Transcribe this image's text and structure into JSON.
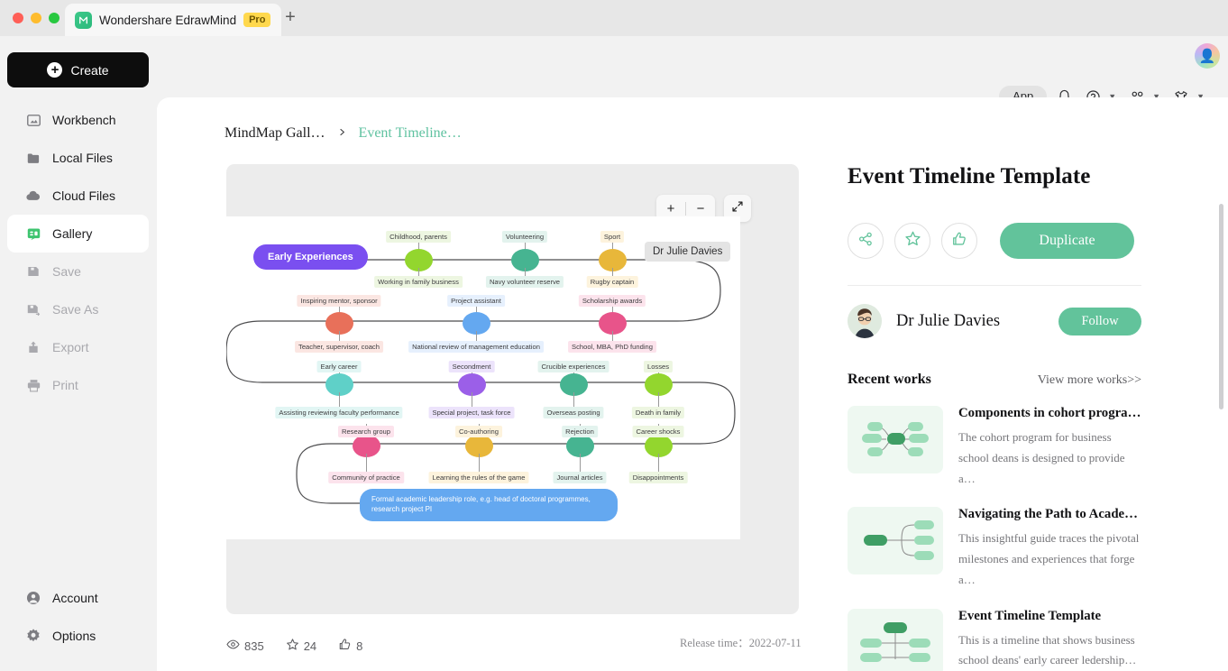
{
  "window": {
    "tab_title": "Wondershare EdrawMind",
    "pro_badge": "Pro",
    "favicon": "edrawmind-logo-icon",
    "new_tab": "+"
  },
  "topbar": {
    "app_label": "App",
    "icons": [
      "bell-icon",
      "help-icon",
      "apps-grid-icon",
      "theme-shirt-icon"
    ],
    "avatar": "user-avatar"
  },
  "sidebar": {
    "create_label": "Create",
    "items": [
      {
        "label": "Workbench",
        "icon": "workbench-icon",
        "state": "normal"
      },
      {
        "label": "Local Files",
        "icon": "folder-icon",
        "state": "normal"
      },
      {
        "label": "Cloud Files",
        "icon": "cloud-icon",
        "state": "normal"
      },
      {
        "label": "Gallery",
        "icon": "gallery-icon",
        "state": "active"
      },
      {
        "label": "Save",
        "icon": "save-icon",
        "state": "disabled"
      },
      {
        "label": "Save As",
        "icon": "save-as-icon",
        "state": "disabled"
      },
      {
        "label": "Export",
        "icon": "export-icon",
        "state": "disabled"
      },
      {
        "label": "Print",
        "icon": "print-icon",
        "state": "disabled"
      }
    ],
    "bottom_items": [
      {
        "label": "Account",
        "icon": "account-icon"
      },
      {
        "label": "Options",
        "icon": "gear-icon"
      }
    ]
  },
  "breadcrumb": {
    "first": "MindMap Gall…",
    "separator": "›",
    "current": "Event Timeline…"
  },
  "preview": {
    "zoom_in": "+",
    "zoom_out": "−",
    "expand": "expand-icon",
    "watermark": "Dr Julie Davies"
  },
  "chart_data": {
    "type": "diagram",
    "title": "Event Timeline Template",
    "root": {
      "label": "Early Experiences",
      "color": "#7a4ff0"
    },
    "banner": "Formal academic leadership role, e.g. head of doctoral programmes, research project PI",
    "banner_color": "#64a8f0",
    "rows": [
      {
        "row": 1,
        "nodes": [
          {
            "color": "#93d62e",
            "above": "Childhood, parents",
            "below": "Working in family business",
            "above_bg": "#edf6e1",
            "below_bg": "#edf6e1"
          },
          {
            "color": "#46b491",
            "above": "Volunteering",
            "below": "Navy volunteer reserve",
            "above_bg": "#e3f3ee",
            "below_bg": "#e3f3ee"
          },
          {
            "color": "#e8b73a",
            "above": "Sport",
            "below": "Rugby captain",
            "above_bg": "#fdf3dd",
            "below_bg": "#fdf3dd"
          }
        ]
      },
      {
        "row": 2,
        "nodes": [
          {
            "color": "#e8705a",
            "above": "Inspiring mentor, sponsor",
            "below": "Teacher, supervisor, coach",
            "above_bg": "#fbe6e2",
            "below_bg": "#fbe6e2"
          },
          {
            "color": "#64a8f0",
            "above": "Project assistant",
            "below": "National review of management education",
            "above_bg": "#e6f0fd",
            "below_bg": "#e6f0fd"
          },
          {
            "color": "#e8548a",
            "above": "Scholarship awards",
            "below": "School, MBA, PhD funding",
            "above_bg": "#fce3ec",
            "below_bg": "#fce3ec"
          }
        ]
      },
      {
        "row": 3,
        "nodes": [
          {
            "color": "#5fd0c8",
            "above": "Early career",
            "below": "Assisting reviewing faculty performance",
            "above_bg": "#e2f6f4",
            "below_bg": "#e2f6f4"
          },
          {
            "color": "#9b5fe8",
            "above": "Secondment",
            "below": "Special project, task force",
            "above_bg": "#ece3fb",
            "below_bg": "#ece3fb"
          },
          {
            "color": "#46b491",
            "above": "Crucible experiences",
            "below": "Overseas posting",
            "above_bg": "#e3f3ee",
            "below_bg": "#e3f3ee"
          },
          {
            "color": "#93d62e",
            "above": "Losses",
            "below": "Death in family",
            "above_bg": "#edf6e1",
            "below_bg": "#edf6e1"
          }
        ]
      },
      {
        "row": 4,
        "nodes": [
          {
            "color": "#e8548a",
            "above": "Research group",
            "below": "Community of practice",
            "above_bg": "#fce3ec",
            "below_bg": "#fce3ec"
          },
          {
            "color": "#e8b73a",
            "above": "Co-authoring",
            "below": "Learning the rules of the game",
            "above_bg": "#fdf3dd",
            "below_bg": "#fdf3dd"
          },
          {
            "color": "#46b491",
            "above": "Rejection",
            "below": "Journal articles",
            "above_bg": "#e3f3ee",
            "below_bg": "#e3f3ee"
          },
          {
            "color": "#93d62e",
            "above": "Career shocks",
            "below": "Disappointments",
            "above_bg": "#edf6e1",
            "below_bg": "#edf6e1"
          }
        ]
      }
    ]
  },
  "stats": {
    "views_icon": "eye-icon",
    "views": "835",
    "stars_icon": "star-icon",
    "stars": "24",
    "likes_icon": "thumbs-up-icon",
    "likes": "8",
    "release_label": "Release time：",
    "release_date": "2022-07-11"
  },
  "detail": {
    "title": "Event Timeline Template",
    "share_icon": "share-icon",
    "favorite_icon": "star-icon",
    "like_icon": "thumbs-up-icon",
    "duplicate_label": "Duplicate",
    "author": "Dr Julie Davies",
    "follow_label": "Follow",
    "recent_title": "Recent works",
    "view_more": "View more works>>",
    "works": [
      {
        "title": "Components in cohort progra…",
        "desc": "The cohort program for business school deans is designed to provide a…",
        "thumb": "mindmap-radial-thumb"
      },
      {
        "title": "Navigating the Path to Academ…",
        "desc": "This insightful guide traces the pivotal milestones and experiences that forge a…",
        "thumb": "mindmap-right-thumb"
      },
      {
        "title": "Event Timeline Template",
        "desc": "This is a timeline that shows business school deans' early career ledership…",
        "thumb": "mindmap-tree-thumb"
      }
    ]
  },
  "colors": {
    "accent": "#62c39b",
    "brand_purple": "#7a4ff0",
    "pro_yellow": "#ffd84d"
  }
}
